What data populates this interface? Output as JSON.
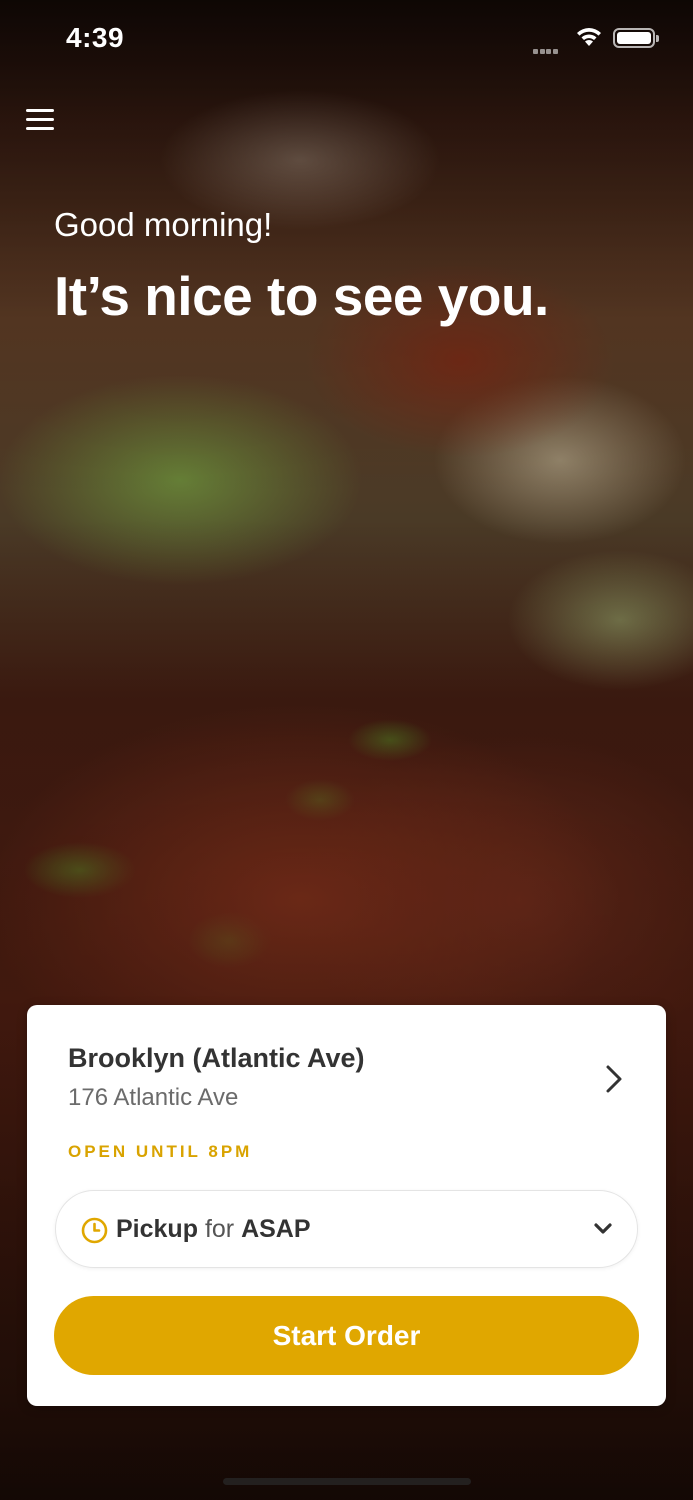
{
  "status_bar": {
    "time": "4:39"
  },
  "header": {
    "menu_icon": "hamburger-menu-icon"
  },
  "hero": {
    "greeting": "Good morning!",
    "headline": "It’s nice to see you."
  },
  "location_card": {
    "store_name": "Brooklyn (Atlantic Ave)",
    "store_address": "176 Atlantic Ave",
    "hours": "OPEN UNTIL 8PM",
    "order_mode": {
      "mode": "Pickup",
      "separator": "for",
      "time": "ASAP"
    },
    "start_order_label": "Start Order"
  },
  "colors": {
    "accent": "#e0a700",
    "hours_text": "#d9a300",
    "card_background": "#ffffff",
    "primary_text": "#333333",
    "secondary_text": "#6b6b6b"
  }
}
